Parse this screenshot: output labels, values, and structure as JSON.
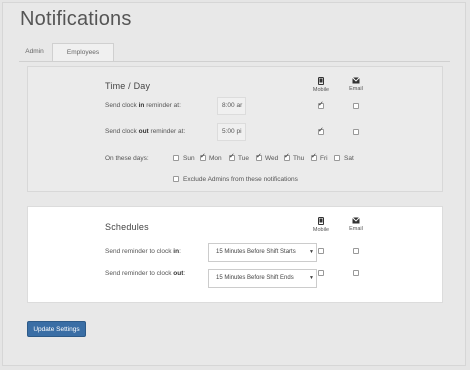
{
  "page": {
    "title": "Notifications"
  },
  "tabs": [
    {
      "label": "Admin",
      "active": false
    },
    {
      "label": "Employees",
      "active": true
    }
  ],
  "columns": {
    "mobile": "Mobile",
    "email": "Email"
  },
  "time_day": {
    "title": "Time / Day",
    "clock_in": {
      "prefix": "Send clock ",
      "bold": "in",
      "suffix": " reminder at:",
      "time": "8:00 ar",
      "mobile": true,
      "email": false
    },
    "clock_out": {
      "prefix": "Send clock ",
      "bold": "out",
      "suffix": " reminder at:",
      "time": "5:00 pi",
      "mobile": true,
      "email": false
    },
    "days_label": "On these days:",
    "days": [
      {
        "label": "Sun",
        "checked": false
      },
      {
        "label": "Mon",
        "checked": true
      },
      {
        "label": "Tue",
        "checked": true
      },
      {
        "label": "Wed",
        "checked": true
      },
      {
        "label": "Thu",
        "checked": true
      },
      {
        "label": "Fri",
        "checked": true
      },
      {
        "label": "Sat",
        "checked": false
      }
    ],
    "exclude_admins": {
      "label": "Exclude Admins from these notifications",
      "checked": false
    }
  },
  "schedules": {
    "title": "Schedules",
    "clock_in": {
      "prefix": "Send reminder to clock ",
      "bold": "in",
      "suffix": ":",
      "value": "15 Minutes Before Shift Starts",
      "mobile": false,
      "email": false
    },
    "clock_out": {
      "prefix": "Send reminder to clock ",
      "bold": "out",
      "suffix": ":",
      "value": "15 Minutes Before Shift Ends",
      "mobile": false,
      "email": false
    }
  },
  "actions": {
    "update_label": "Update Settings"
  },
  "colors": {
    "button": "#3a6ea5",
    "background": "#e8e8e8",
    "panel_white": "#ffffff"
  },
  "icons": {
    "mobile": "mobile-phone-icon",
    "email": "envelope-icon"
  }
}
